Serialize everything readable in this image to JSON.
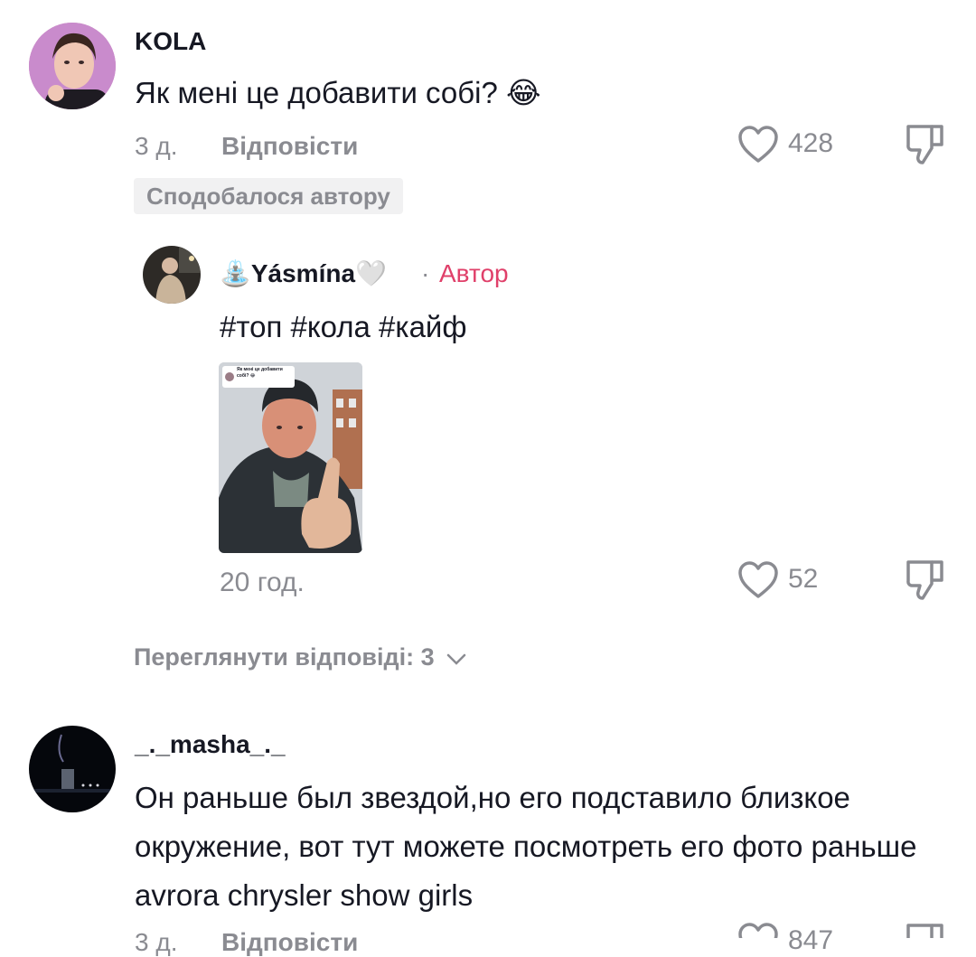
{
  "comments": [
    {
      "username": "KOLA",
      "text": "Як мені це добавити собі? 😂",
      "time": "3 д.",
      "reply_label": "Відповісти",
      "likes": "428",
      "badge": "Сподобалося автору",
      "icons": {
        "like": "heart-outline-icon",
        "dislike": "thumbs-down-icon"
      }
    },
    {
      "username": "_._masha_._",
      "text": "Он раньше был звездой,но его подставило близкое окружение, вот тут можете посмотреть его фото раньше avrora chrysler show girls",
      "time": "3 д.",
      "reply_label": "Відповісти",
      "likes": "847"
    }
  ],
  "reply": {
    "username": "⛲Yásmína🤍",
    "separator": "·",
    "author_label": "Автор",
    "text": "#топ #кола #кайф",
    "time": "20 год.",
    "likes": "52",
    "thumb_caption": "Як мені це добавити собі? 😂"
  },
  "view_replies": {
    "label": "Переглянути відповіді: 3",
    "icon": "chevron-down-icon"
  },
  "colors": {
    "text": "#161823",
    "muted": "#8a8b91",
    "author": "#e0406a",
    "badge_bg": "#f1f1f2"
  }
}
